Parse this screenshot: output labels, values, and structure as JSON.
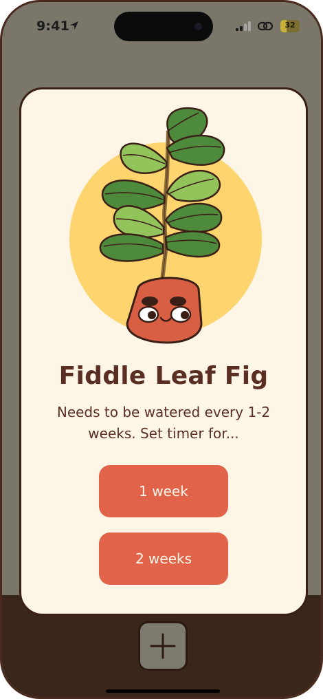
{
  "status_bar": {
    "time": "9:41",
    "battery_level": "32",
    "battery_fraction": 0.32,
    "icons": [
      "location-arrow-icon",
      "signal-bars-icon",
      "link-icon",
      "battery-icon"
    ]
  },
  "plant": {
    "name": "Fiddle Leaf Fig",
    "description": "Needs to be watered every 1-2 weeks. Set timer for..."
  },
  "timer_options": {
    "option_1": "1 week",
    "option_2": "2 weeks"
  },
  "add_button": {
    "icon": "plus-icon"
  },
  "colors": {
    "background": "#7a766a",
    "floor": "#3a261b",
    "card": "#fdf6e6",
    "card_border": "#3a1f16",
    "text": "#5a2e22",
    "button": "#e0634a",
    "button_text": "#fff6ea",
    "sun": "#fdd46e",
    "pot": "#d95f44",
    "leaf_dark": "#4e8a3c",
    "leaf_light": "#93c45b"
  }
}
